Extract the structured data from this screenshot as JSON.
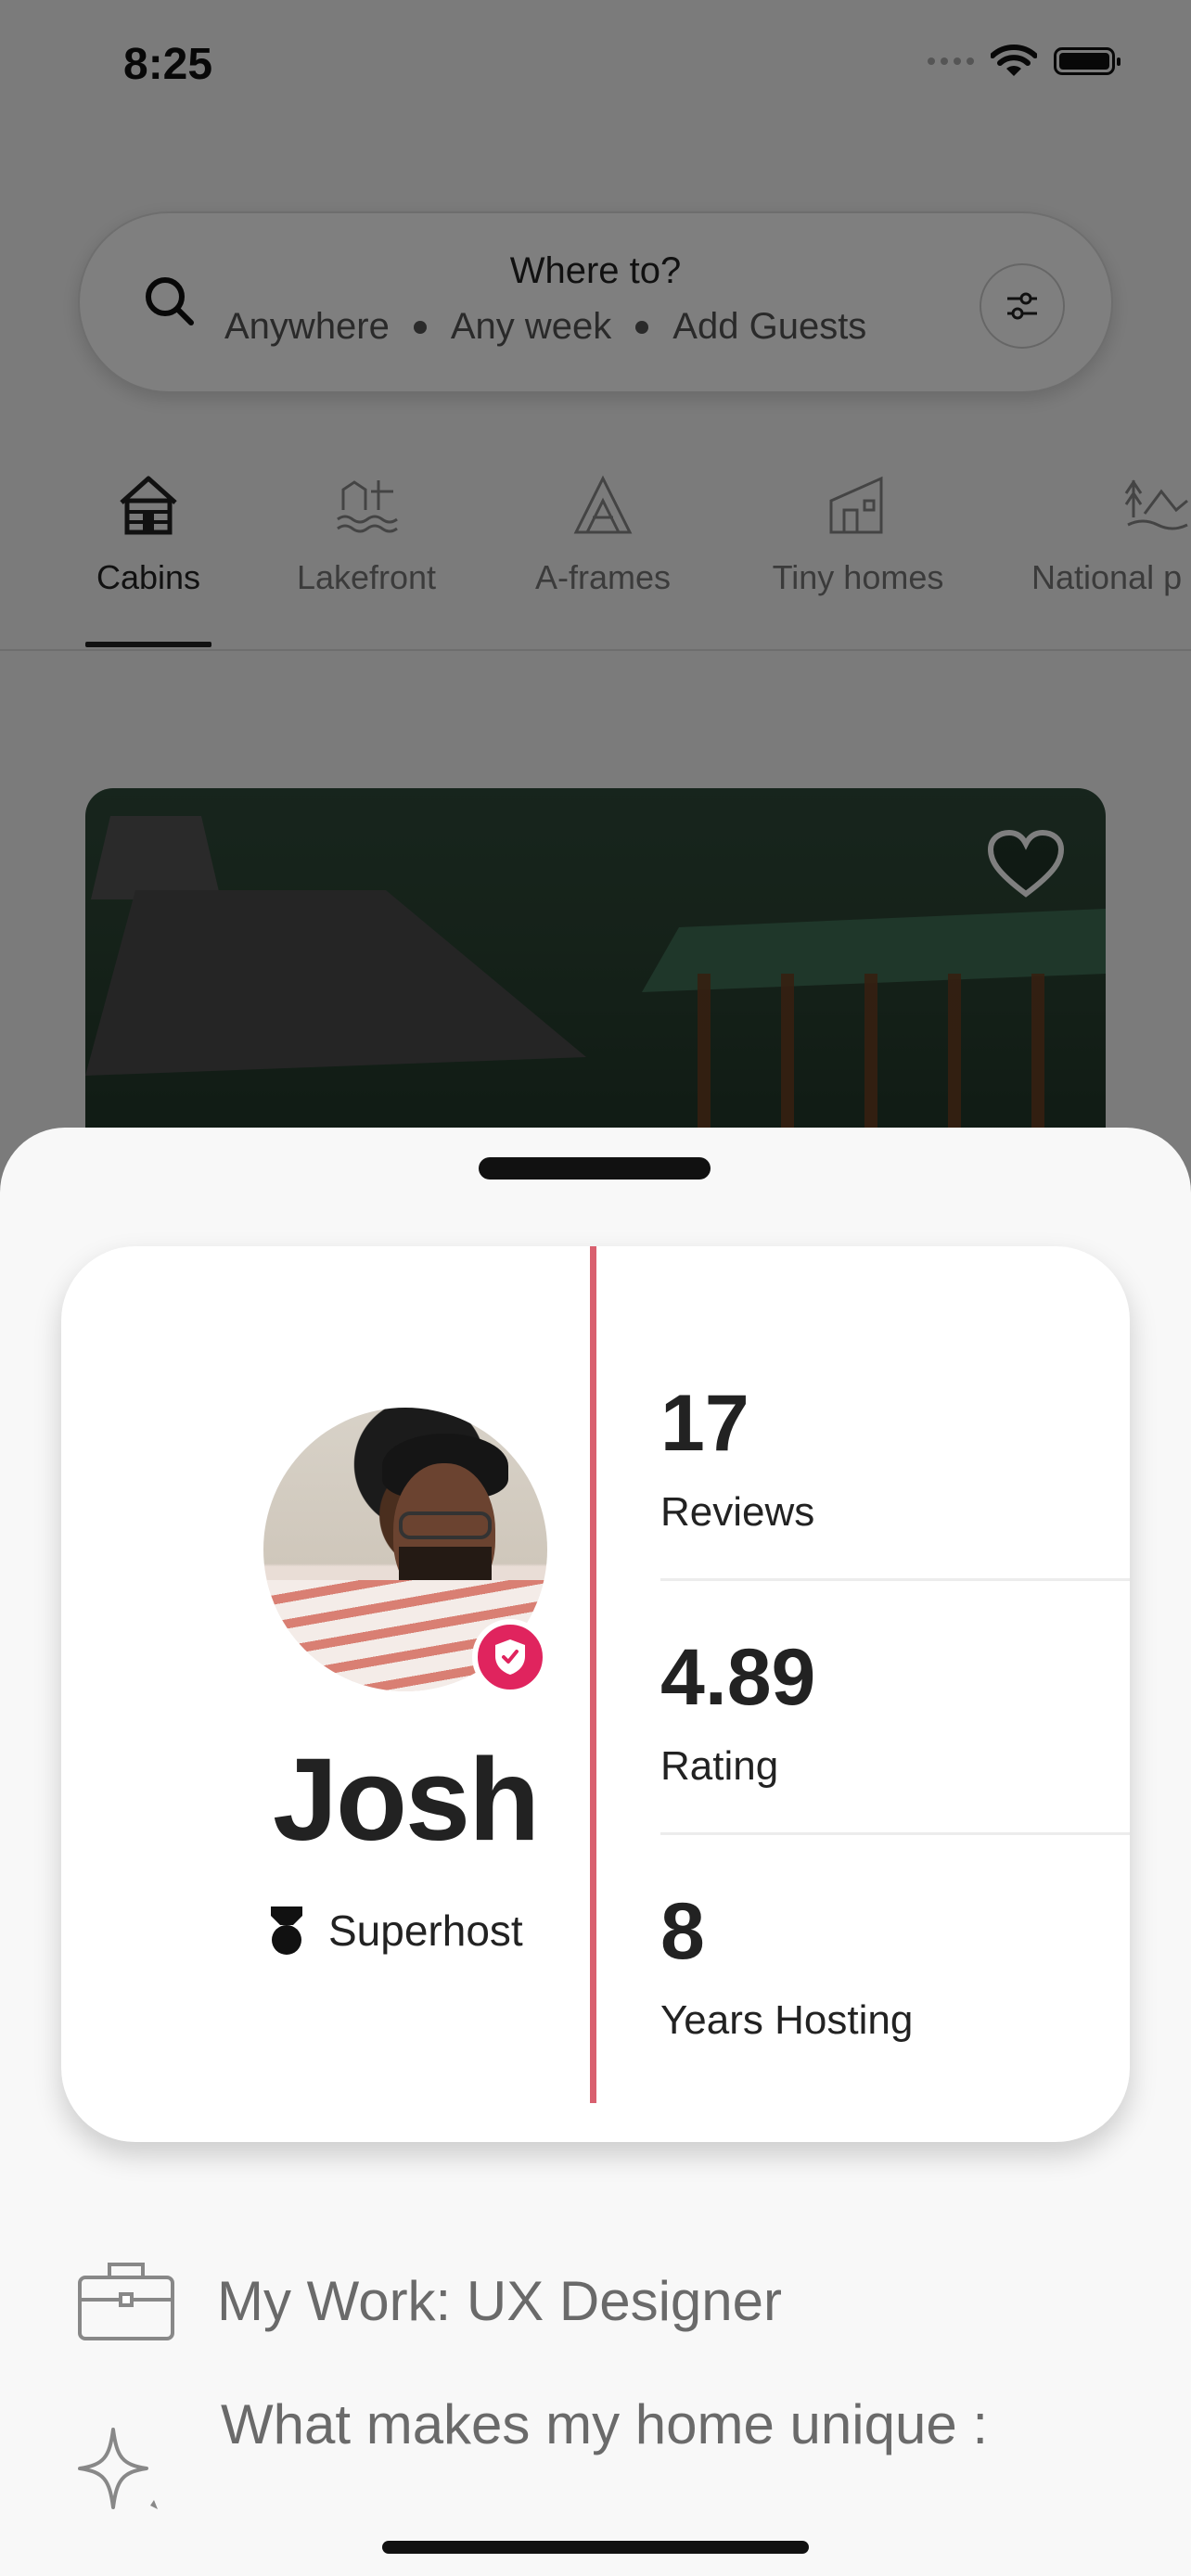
{
  "status_bar": {
    "time": "8:25"
  },
  "search": {
    "title": "Where to?",
    "location": "Anywhere",
    "dates": "Any week",
    "guests": "Add Guests"
  },
  "categories": [
    {
      "label": "Cabins",
      "icon": "cabin-icon",
      "active": true
    },
    {
      "label": "Lakefront",
      "icon": "lakefront-icon"
    },
    {
      "label": "A-frames",
      "icon": "a-frame-icon"
    },
    {
      "label": "Tiny homes",
      "icon": "tiny-home-icon"
    },
    {
      "label": "National p",
      "icon": "national-park-icon"
    }
  ],
  "host_card": {
    "name": "Josh",
    "role": "Superhost",
    "stats": [
      {
        "value": "17",
        "label": "Reviews"
      },
      {
        "value": "4.89",
        "label": "Rating"
      },
      {
        "value": "8",
        "label": "Years Hosting"
      }
    ]
  },
  "about": {
    "work": "My Work: UX Designer",
    "unique": "What makes my home unique :"
  },
  "colors": {
    "accent": "#e0245e",
    "divider": "#d9606f"
  }
}
